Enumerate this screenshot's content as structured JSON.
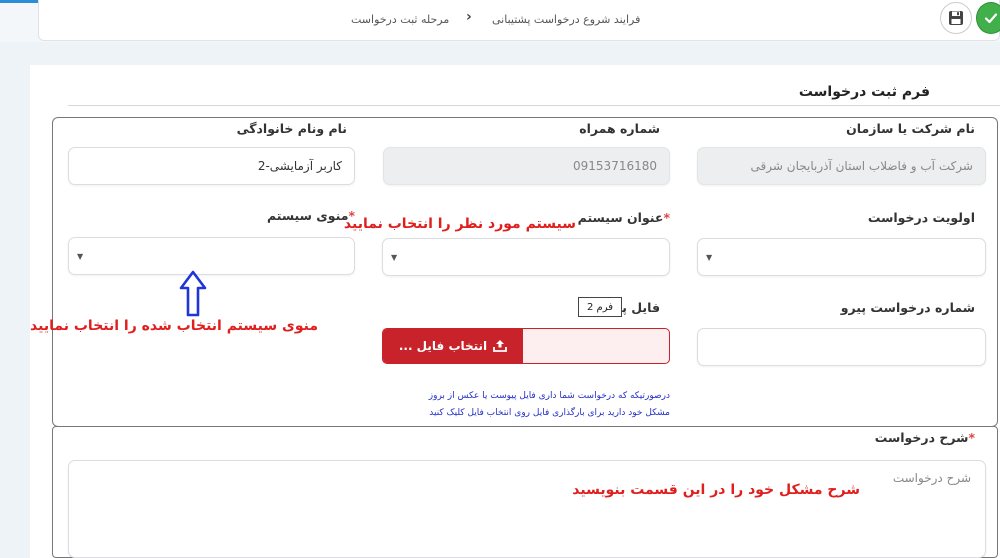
{
  "breadcrumb": {
    "current": "مرحله ثبت درخواست",
    "parent": "فرایند شروع درخواست پشتیبانی"
  },
  "toolbar": {
    "save_icon": "floppy-disk-icon",
    "confirm_icon": "check-icon"
  },
  "form": {
    "title": "فرم ثبت درخواست",
    "fields": {
      "organization": {
        "label": "نام شرکت یا سازمان",
        "value": "شرکت آب و فاضلاب استان آذربایجان شرقی"
      },
      "mobile": {
        "label": "شماره همراه",
        "value": "09153716180"
      },
      "fullname": {
        "label": "نام ونام خانوادگی",
        "value": "کاربر آزمایشی-2"
      },
      "priority": {
        "label": "اولویت درخواست",
        "value": ""
      },
      "system_title": {
        "label": "عنوان سیستم",
        "required_mark": "*",
        "value": ""
      },
      "system_menu": {
        "label": "منوی سیستم",
        "required_mark": "*",
        "value": ""
      },
      "followup_number": {
        "label": "شماره درخواست پیرو",
        "value": ""
      },
      "file": {
        "label": "فایل پی",
        "button_label": "انتخاب فایل ...",
        "tag": "فرم 2"
      }
    },
    "file_note_line1": "درصورتیکه که درخواست شما داری فایل پیوست یا عکس از بروز",
    "file_note_line2": "مشکل خود دارید برای بارگذاری فایل روی انتخاب فایل کلیک کنید",
    "description": {
      "label": "شرح درخواست",
      "required_mark": "*",
      "placeholder": "شرح درخواست"
    }
  },
  "annotations": {
    "system_title_hint": "سیستم مورد نظر را انتخاب نمایید",
    "system_menu_hint": "منوی سیستم انتخاب شده را انتخاب نمایید",
    "description_hint": "شرح مشکل خود را در این قسمت بنویسید"
  },
  "colors": {
    "accent_red": "#c8222a",
    "annotation_red": "#e01e1e",
    "arrow_blue": "#1f35d6",
    "confirm_green": "#41b04a"
  }
}
